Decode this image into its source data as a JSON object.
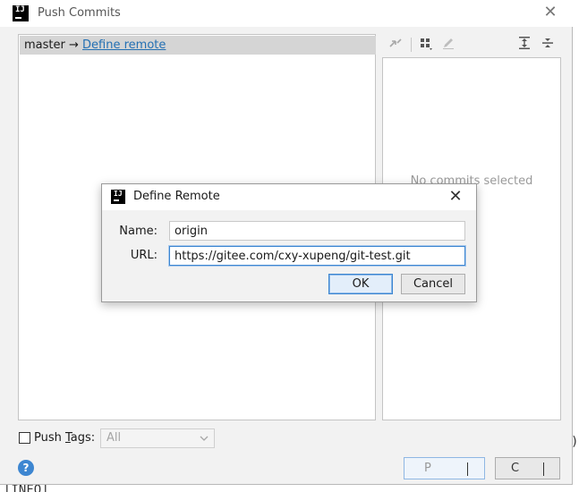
{
  "window": {
    "title": "Push Commits",
    "logo_text": "IJ",
    "close_glyph": "✕"
  },
  "branch": {
    "local": "master",
    "arrow": "→",
    "link_label": "Define remote"
  },
  "details": {
    "empty_text": "No commits selected"
  },
  "bottom": {
    "push_tags_label": "Push Tags:",
    "push_tags_mnemonic_prefix": "Push ",
    "push_tags_mnemonic_letter": "T",
    "push_tags_mnemonic_suffix": "ags:",
    "tags_select_value": "All",
    "help_glyph": "?",
    "push_button_text": "P",
    "cancel_button_text": "C"
  },
  "dialog": {
    "title": "Define Remote",
    "logo_text": "IJ",
    "close_glyph": "✕",
    "name_label": "Name:",
    "name_value": "origin",
    "url_label": "URL:",
    "url_value": "https://gitee.com/cxy-xupeng/git-test.git",
    "ok_label": "OK",
    "cancel_label": "Cancel"
  },
  "background": {
    "fragments": [
      "[",
      "[",
      "[INFO]",
      ")"
    ]
  },
  "icons": {
    "toolbar": [
      "merge-arrows-icon",
      "group-by-icon",
      "edit-icon",
      "expand-all-icon",
      "collapse-all-icon"
    ],
    "chevron": "chevron-down-icon",
    "help": "help-icon"
  },
  "colors": {
    "link": "#2470b3",
    "accent": "#3d86d1",
    "selection_bar": "#d5d5d5",
    "window_bg": "#f2f2f2"
  }
}
